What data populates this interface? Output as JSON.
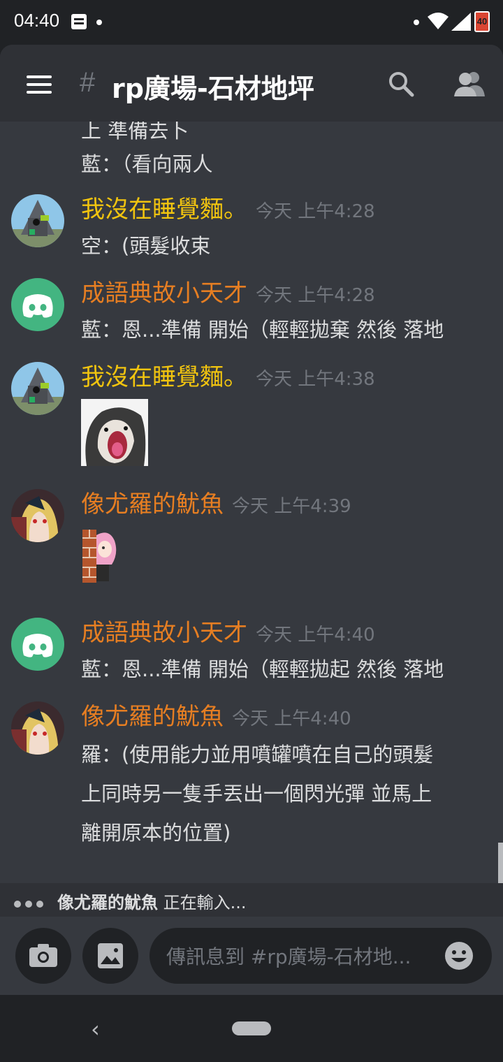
{
  "status_bar": {
    "time": "04:40",
    "battery": "40"
  },
  "header": {
    "channel_hash": "#",
    "channel_name": "rp廣場-石材地坪"
  },
  "messages": {
    "continuation": [
      "上 準備去卜",
      "藍：（看向兩人"
    ],
    "items": [
      {
        "author": "我沒在睡覺麵。",
        "timestamp": "今天 上午4:28",
        "body": "空：(頭髮收束",
        "avatar": "robot-avatar"
      },
      {
        "author": "成語典故小天才",
        "timestamp": "今天 上午4:28",
        "body": "藍：恩...準備 開始（輕輕拋棄 然後  落地",
        "avatar": "discord-logo-avatar"
      },
      {
        "author": "我沒在睡覺麵。",
        "timestamp": "今天 上午4:38",
        "body": "",
        "avatar": "robot-avatar",
        "attachment": "screaming-seal-emoji"
      },
      {
        "author": "像尤羅的魷魚",
        "timestamp": "今天 上午4:39",
        "body": "",
        "avatar": "anime-avatar",
        "attachment": "peeking-wall-emoji"
      },
      {
        "author": "成語典故小天才",
        "timestamp": "今天 上午4:40",
        "body": "藍：恩...準備 開始（輕輕拋起 然後  落地",
        "avatar": "discord-logo-avatar"
      },
      {
        "author": "像尤羅的魷魚",
        "timestamp": "今天 上午4:40",
        "body_lines": [
          "羅：(使用能力並用噴罐噴在自己的頭髮",
          "上同時另一隻手丟出一個閃光彈 並馬上",
          "離開原本的位置)"
        ],
        "avatar": "anime-avatar"
      }
    ]
  },
  "typing": {
    "user": "像尤羅的魷魚",
    "suffix": " 正在輸入..."
  },
  "composer": {
    "placeholder": "傳訊息到 #rp廣場-石材地..."
  },
  "colors": {
    "yellow_role": "#f1c40f",
    "orange_role": "#e67e22",
    "discord_green": "#43b581",
    "background": "#36393f"
  }
}
